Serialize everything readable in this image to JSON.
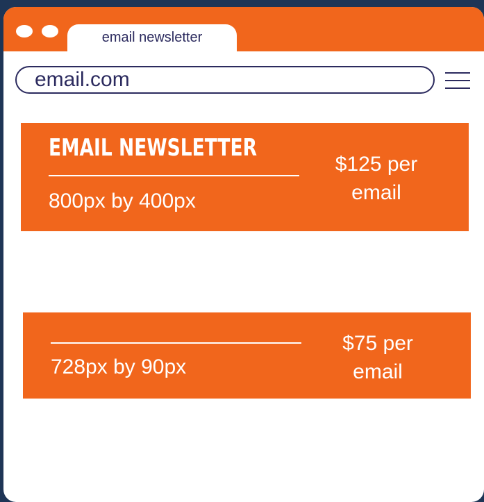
{
  "browser": {
    "tab_title": "email newsletter",
    "url": "email.com"
  },
  "ads": [
    {
      "title": "EMAIL NEWSLETTER",
      "size": "800px by 400px",
      "price_line1": "$125 per",
      "price_line2": "email"
    },
    {
      "size": "728px by 90px",
      "price_line1": "$75 per",
      "price_line2": "email"
    }
  ],
  "colors": {
    "background": "#1e3556",
    "accent": "#f1661c",
    "text_dark": "#2b2a5e",
    "white": "#ffffff"
  },
  "icons": {
    "window_controls": "dot-icon",
    "menu": "menu-icon"
  }
}
